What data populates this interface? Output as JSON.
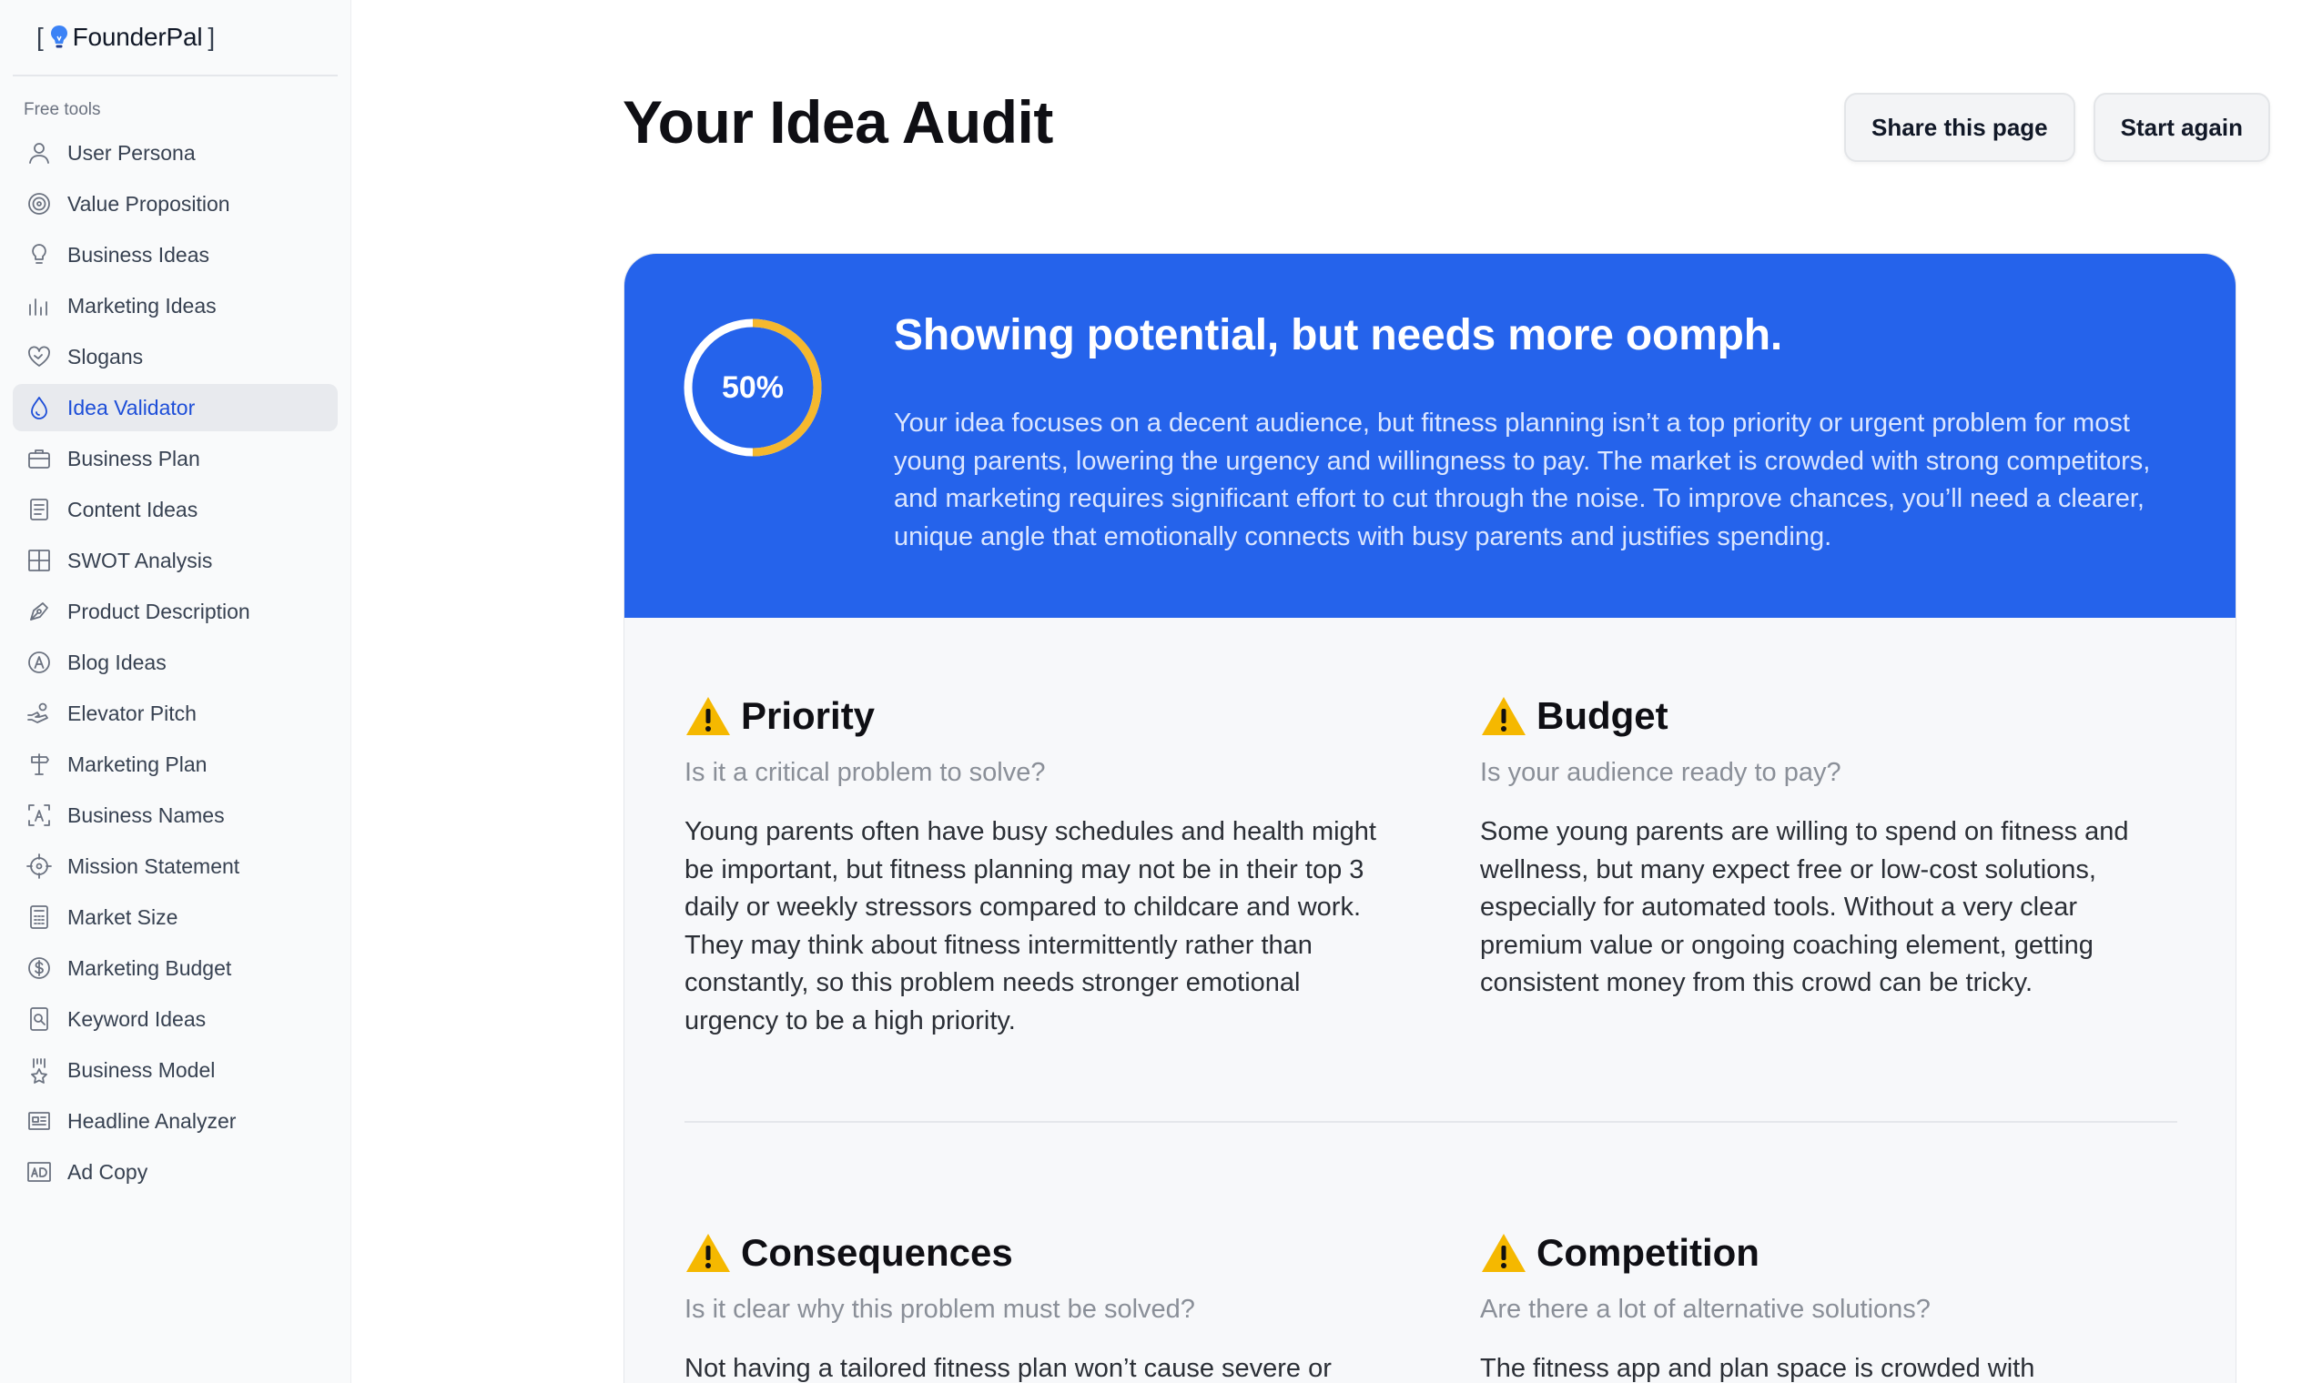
{
  "brand": {
    "open": "[",
    "name": "FounderPal",
    "close": "]"
  },
  "sidebar": {
    "section_label": "Free tools",
    "items": [
      {
        "label": "User Persona",
        "icon": "user-icon"
      },
      {
        "label": "Value Proposition",
        "icon": "target-icon"
      },
      {
        "label": "Business Ideas",
        "icon": "lightbulb-icon"
      },
      {
        "label": "Marketing Ideas",
        "icon": "bar-chart-icon"
      },
      {
        "label": "Slogans",
        "icon": "heart-handshake-icon"
      },
      {
        "label": "Idea Validator",
        "icon": "droplet-icon",
        "active": true
      },
      {
        "label": "Business Plan",
        "icon": "briefcase-icon"
      },
      {
        "label": "Content Ideas",
        "icon": "document-icon"
      },
      {
        "label": "SWOT Analysis",
        "icon": "grid-icon"
      },
      {
        "label": "Product Description",
        "icon": "pen-nib-icon"
      },
      {
        "label": "Blog Ideas",
        "icon": "letter-a-circle-icon"
      },
      {
        "label": "Elevator Pitch",
        "icon": "hand-coin-icon"
      },
      {
        "label": "Marketing Plan",
        "icon": "signpost-icon"
      },
      {
        "label": "Business Names",
        "icon": "text-scan-icon"
      },
      {
        "label": "Mission Statement",
        "icon": "crosshair-icon"
      },
      {
        "label": "Market Size",
        "icon": "calculator-icon"
      },
      {
        "label": "Marketing Budget",
        "icon": "dollar-circle-icon"
      },
      {
        "label": "Keyword Ideas",
        "icon": "file-search-icon"
      },
      {
        "label": "Business Model",
        "icon": "award-ribbon-icon"
      },
      {
        "label": "Headline Analyzer",
        "icon": "newspaper-icon"
      },
      {
        "label": "Ad Copy",
        "icon": "ad-box-icon"
      }
    ]
  },
  "header": {
    "title": "Your Idea Audit",
    "share_label": "Share this page",
    "restart_label": "Start again"
  },
  "score": {
    "percent_label": "50%",
    "percent": 50,
    "ring_color": "#f5b82e",
    "headline": "Showing potential, but needs more oomph.",
    "summary": "Your idea focuses on a decent audience, but fitness planning isn’t a top priority or urgent problem for most young parents, lowering the urgency and willingness to pay. The market is crowded with strong competitors, and marketing requires significant effort to cut through the noise. To improve chances, you’ll need a clearer, unique angle that emotionally connects with busy parents and justifies spending."
  },
  "criteria": [
    {
      "title": "Priority",
      "question": "Is it a critical problem to solve?",
      "answer": "Young parents often have busy schedules and health might be important, but fitness planning may not be in their top 3 daily or weekly stressors compared to childcare and work. They may think about fitness intermittently rather than constantly, so this problem needs stronger emotional urgency to be a high priority."
    },
    {
      "title": "Budget",
      "question": "Is your audience ready to pay?",
      "answer": "Some young parents are willing to spend on fitness and wellness, but many expect free or low-cost solutions, especially for automated tools. Without a very clear premium value or ongoing coaching element, getting consistent money from this crowd can be tricky."
    },
    {
      "title": "Consequences",
      "question": "Is it clear why this problem must be solved?",
      "answer": "Not having a tailored fitness plan won’t cause severe or immediate negative consequences for most young parents."
    },
    {
      "title": "Competition",
      "question": "Are there a lot of alternative solutions?",
      "answer": "The fitness app and plan space is crowded with established brands and strong free and paid options."
    }
  ],
  "colors": {
    "accent": "#2563eb",
    "active_nav": "#1d4ed8",
    "warning": "#f5b800"
  }
}
